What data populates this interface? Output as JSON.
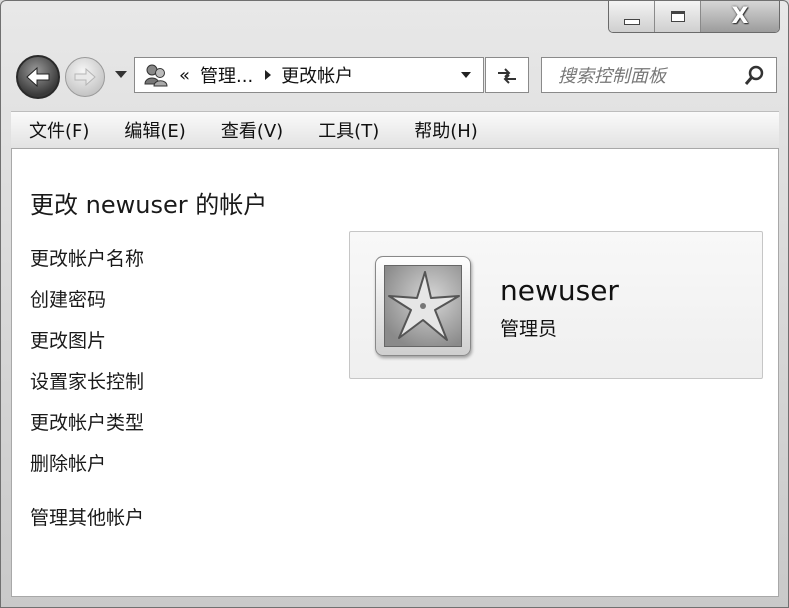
{
  "window": {
    "caption_buttons": [
      {
        "name": "minimize",
        "icon": "minimize-icon"
      },
      {
        "name": "maximize",
        "icon": "maximize-icon"
      },
      {
        "name": "close",
        "label": "X",
        "icon": "close-icon"
      }
    ]
  },
  "navigation": {
    "back_icon": "back-arrow-icon",
    "forward_icon": "forward-arrow-icon",
    "recent_icon": "chevron-down-icon"
  },
  "address_bar": {
    "icon": "users-icon",
    "overflow": "«",
    "segments": [
      "管理...",
      "更改帐户"
    ],
    "dropdown_icon": "chevron-down-icon",
    "refresh_icon": "refresh-icon"
  },
  "search": {
    "placeholder": "搜索控制面板",
    "icon": "search-icon"
  },
  "menu": {
    "items": [
      "文件(F)",
      "编辑(E)",
      "查看(V)",
      "工具(T)",
      "帮助(H)"
    ]
  },
  "page": {
    "title": "更改 newuser 的帐户",
    "tasks": [
      "更改帐户名称",
      "创建密码",
      "更改图片",
      "设置家长控制",
      "更改帐户类型",
      "删除帐户"
    ],
    "other_link": "管理其他帐户"
  },
  "account": {
    "name": "newuser",
    "role": "管理员",
    "avatar_icon": "starfish-avatar"
  }
}
